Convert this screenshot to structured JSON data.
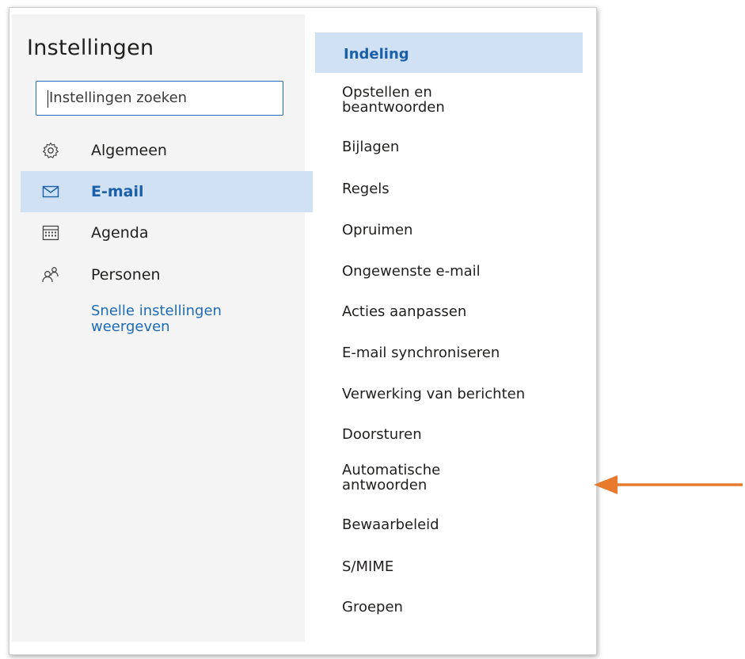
{
  "settings": {
    "title": "Instellingen",
    "search": {
      "value": "Instellingen zoeken",
      "placeholder": "Instellingen zoeken"
    },
    "nav": [
      {
        "label": "Algemeen",
        "icon": "gear-icon",
        "active": false
      },
      {
        "label": "E-mail",
        "icon": "mail-icon",
        "active": true
      },
      {
        "label": "Agenda",
        "icon": "calendar-icon",
        "active": false
      },
      {
        "label": "Personen",
        "icon": "people-icon",
        "active": false
      }
    ],
    "quick_settings_link": "Snelle instellingen weergeven"
  },
  "mail_sections": [
    {
      "label": "Indeling",
      "active": true
    },
    {
      "label": "Opstellen en beantwoorden"
    },
    {
      "label": "Bijlagen"
    },
    {
      "label": "Regels"
    },
    {
      "label": "Opruimen"
    },
    {
      "label": "Ongewenste e-mail"
    },
    {
      "label": "Acties aanpassen"
    },
    {
      "label": "E-mail synchroniseren"
    },
    {
      "label": "Verwerking van berichten"
    },
    {
      "label": "Doorsturen"
    },
    {
      "label": "Automatische antwoorden"
    },
    {
      "label": "Bewaarbeleid"
    },
    {
      "label": "S/MIME"
    },
    {
      "label": "Groepen"
    }
  ],
  "colors": {
    "accent": "#1a5fa8",
    "selected_bg": "#cfe1f3",
    "left_pane_bg": "#f4f4f4",
    "annotation_arrow": "#e87a2d"
  },
  "annotation": {
    "icon": "arrow-left-icon",
    "points_to": "Automatische antwoorden"
  }
}
